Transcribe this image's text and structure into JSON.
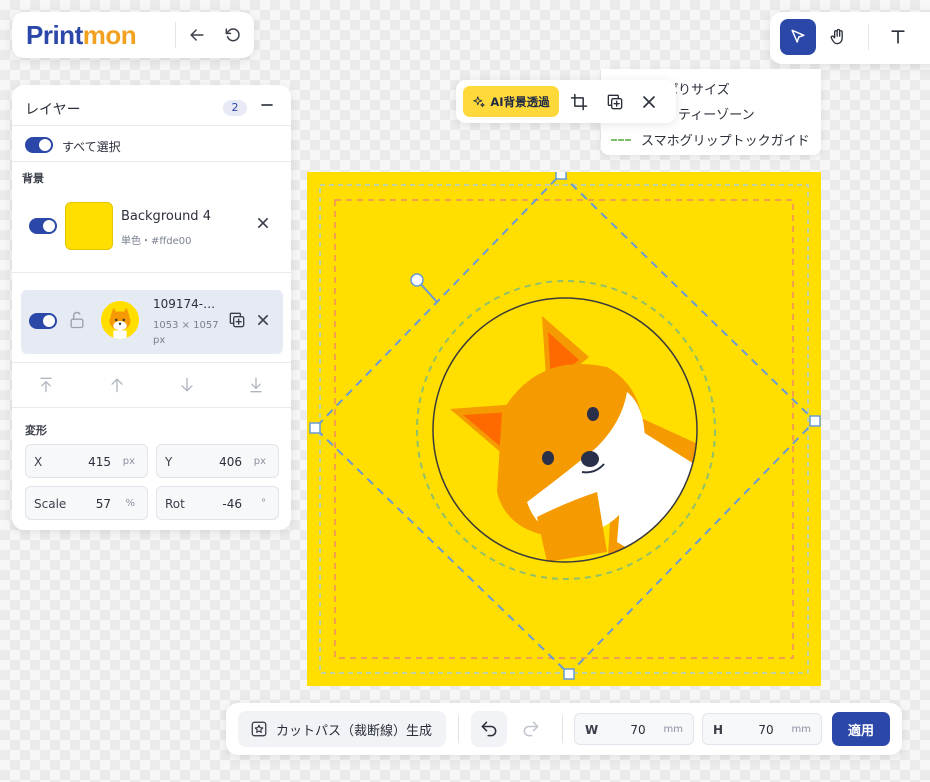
{
  "brand": {
    "logo_part1": "Print",
    "logo_part2": "mon"
  },
  "guide_menu": {
    "items": [
      "ぱりサイズ",
      "ィティーゾーン",
      "スマホグリップトックガイド"
    ]
  },
  "image_toolbar": {
    "ai_button_label": "AI背景透過"
  },
  "layer_panel": {
    "title": "レイヤー",
    "count": "2",
    "select_all_label": "すべて選択",
    "background_section_label": "背景",
    "background_layer": {
      "name": "Background 4",
      "subtitle": "単色・#ffde00",
      "color": "#ffde00"
    },
    "image_layer": {
      "name": "109174-…",
      "dimensions": "1053 × 1057",
      "unit": "px"
    },
    "transform_section_label": "変形",
    "transform": {
      "x": {
        "label": "X",
        "value": "415",
        "unit": "px"
      },
      "y": {
        "label": "Y",
        "value": "406",
        "unit": "px"
      },
      "scale": {
        "label": "Scale",
        "value": "57",
        "unit": "%"
      },
      "rot": {
        "label": "Rot",
        "value": "-46",
        "unit": "°"
      }
    }
  },
  "bottom_bar": {
    "cutpath_label": "カットパス（裁断線）生成",
    "width": {
      "label": "W",
      "value": "70",
      "unit": "mm"
    },
    "height": {
      "label": "H",
      "value": "70",
      "unit": "mm"
    },
    "apply_label": "適用"
  },
  "colors": {
    "accent": "#2b48a8",
    "artboard": "#ffde00",
    "ai_button": "#ffd93a"
  }
}
